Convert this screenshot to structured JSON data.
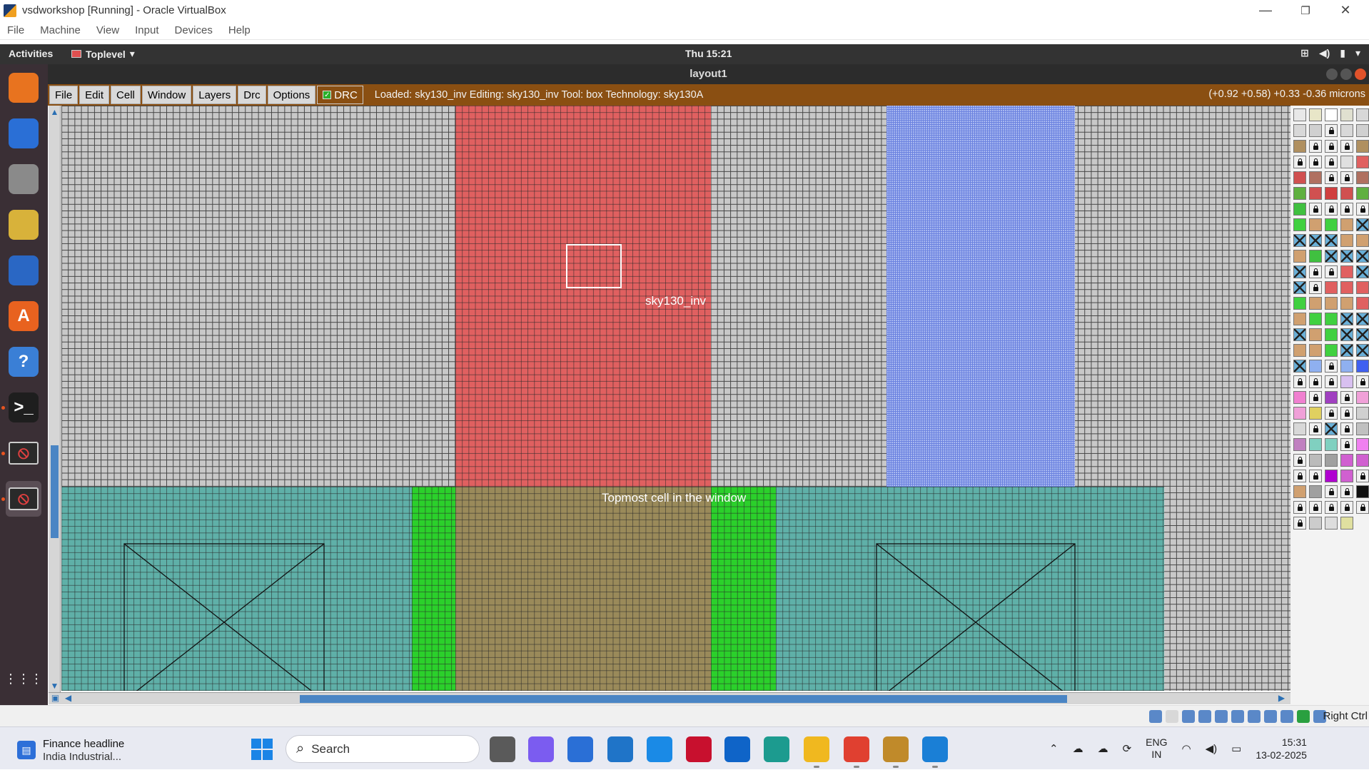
{
  "host": {
    "title": "vsdworkshop [Running] - Oracle VirtualBox",
    "menu": [
      "File",
      "Machine",
      "View",
      "Input",
      "Devices",
      "Help"
    ],
    "controls": {
      "minimize": "—",
      "restore": "❐",
      "close": "✕"
    }
  },
  "gnome": {
    "activities": "Activities",
    "app_menu": "Toplevel",
    "clock": "Thu 15:21",
    "tray_icons": [
      "network-icon",
      "volume-icon",
      "battery-icon",
      "arrow-down-icon"
    ]
  },
  "dock": {
    "items": [
      {
        "name": "firefox-icon",
        "color": "#e8731f",
        "glyph": ""
      },
      {
        "name": "thunderbird-icon",
        "color": "#2a6fd6",
        "glyph": ""
      },
      {
        "name": "files-icon",
        "color": "#8a8a8a",
        "glyph": ""
      },
      {
        "name": "rhythmbox-icon",
        "color": "#d8b23a",
        "glyph": ""
      },
      {
        "name": "writer-icon",
        "color": "#2a67c4",
        "glyph": ""
      },
      {
        "name": "software-icon",
        "color": "#e8621f",
        "glyph": "A"
      },
      {
        "name": "help-icon",
        "color": "#3a7fd6",
        "glyph": "?"
      },
      {
        "name": "terminal-icon",
        "color": "#1e1e1e",
        "glyph": ">_"
      },
      {
        "name": "magic-window-icon",
        "color": "#2a2a2a",
        "glyph": "⦸"
      },
      {
        "name": "magic-window-icon-2",
        "color": "#2a2a2a",
        "glyph": "⦸"
      }
    ],
    "show_apps": "⋮⋮⋮"
  },
  "magic": {
    "window_title": "layout1",
    "menu": [
      "File",
      "Edit",
      "Cell",
      "Window",
      "Layers",
      "Drc",
      "Options"
    ],
    "drc_label": "DRC",
    "status": "Loaded: sky130_inv Editing: sky130_inv Tool: box  Technology: sky130A",
    "coords": "(+0.92 +0.58) +0.33 -0.36 microns",
    "cell_label": "sky130_inv",
    "topmost_label": "Topmost cell in the window",
    "layer_colors": {
      "poly": "#e06060",
      "metal": "#a8b8f0",
      "diffusion": "#5fb0a8",
      "implant": "#2bd02b",
      "gate": "#9a8a5a"
    }
  },
  "palette": {
    "rows": [
      [
        "#e8e8e8",
        "#e8e6c8",
        "#ffffff",
        "#e0e0d0",
        "#d8d8d8"
      ],
      [
        "#d8d8d8",
        "#d0d0d0",
        "lock",
        "#d8d8d8",
        "#d0d0d0"
      ],
      [
        "#b09060",
        "lock",
        "lock",
        "lock",
        "#b09060"
      ],
      [
        "lock",
        "lock",
        "lock",
        "#e0e0e0",
        "#e06060"
      ],
      [
        "#d05050",
        "#b07060",
        "lock",
        "lock",
        "#b07060"
      ],
      [
        "#5fb040",
        "#d05050",
        "#d04040",
        "#d05050",
        "#5fb040"
      ],
      [
        "#40c040",
        "lock",
        "lock",
        "lock",
        "lock"
      ],
      [
        "#40d040",
        "#d0a070",
        "#40d040",
        "#d0a070",
        "cross"
      ],
      [
        "cross",
        "cross",
        "cross",
        "#d0a070",
        "#d0a070"
      ],
      [
        "#d0a070",
        "#40c040",
        "cross",
        "cross",
        "cross"
      ],
      [
        "cross",
        "lock",
        "lock",
        "#e06060",
        "cross"
      ],
      [
        "cross",
        "lock",
        "#e06060",
        "#e06060",
        "#e06060"
      ],
      [
        "#40d040",
        "#d0a070",
        "#d0a070",
        "#d0a070",
        "#e06060"
      ],
      [
        "#d0a070",
        "#40d040",
        "#40d040",
        "cross",
        "cross"
      ],
      [
        "cross",
        "#d0a070",
        "#40d040",
        "cross",
        "cross"
      ],
      [
        "#d0a070",
        "#d0a070",
        "#40d040",
        "cross",
        "cross"
      ],
      [
        "cross",
        "#8fb0f0",
        "lock",
        "#8fb0f0",
        "#4060f0"
      ],
      [
        "lock",
        "lock",
        "lock",
        "#d8c0f0",
        "lock"
      ],
      [
        "#f080d0",
        "lock",
        "#a040c0",
        "lock",
        "#f0a0d8"
      ],
      [
        "#f0a0d8",
        "#e0d060",
        "lock",
        "lock",
        "#d0d0d0"
      ],
      [
        "#d8d8d8",
        "lock",
        "cross",
        "lock",
        "#c0c0c0"
      ],
      [
        "#c080c0",
        "#80d0c0",
        "#80d0c0",
        "lock",
        "#f080f0"
      ],
      [
        "lock",
        "#bbbbbb",
        "#a0a0a0",
        "#d060d0",
        "#d060d0"
      ],
      [
        "lock",
        "lock",
        "#b000d0",
        "#d060d0",
        "lock"
      ],
      [
        "#d0a070",
        "#a0a0a0",
        "lock",
        "lock",
        "#111111"
      ],
      [
        "lock",
        "lock",
        "lock",
        "lock",
        "lock"
      ],
      [
        "lock",
        "#cccccc",
        "#dddddd",
        "#e0e0a0",
        ""
      ]
    ]
  },
  "vb_status": {
    "icons": [
      "hdd-icon",
      "optical-icon",
      "audio-icon",
      "network-icon",
      "usb-icon",
      "shared-folder-icon",
      "display-icon",
      "capture-icon",
      "cpu-icon",
      "mouse-integration-icon",
      "keyboard-icon"
    ],
    "host_key": "Right Ctrl"
  },
  "taskbar": {
    "news_title": "Finance headline",
    "news_sub": "India Industrial...",
    "search_placeholder": "Search",
    "apps": [
      {
        "name": "task-view-icon",
        "color": "#5a5a5a"
      },
      {
        "name": "copilot-icon",
        "color": "#7b5cf0"
      },
      {
        "name": "store-icon",
        "color": "#2a6fd6"
      },
      {
        "name": "hp-icon",
        "color": "#1f74c8"
      },
      {
        "name": "support-assistant-icon",
        "color": "#1a8ae6"
      },
      {
        "name": "mcafee-icon",
        "color": "#c8102e"
      },
      {
        "name": "outlook-icon",
        "color": "#0f64c8"
      },
      {
        "name": "edge-icon",
        "color": "#1c9b8f"
      },
      {
        "name": "file-explorer-icon",
        "color": "#f0b81f"
      },
      {
        "name": "chrome-icon",
        "color": "#e04030"
      },
      {
        "name": "virtualbox-icon",
        "color": "#c08a2a"
      },
      {
        "name": "vscode-icon",
        "color": "#1a7fd6"
      }
    ],
    "lang_1": "ENG",
    "lang_2": "IN",
    "time": "15:31",
    "date": "13-02-2025"
  }
}
